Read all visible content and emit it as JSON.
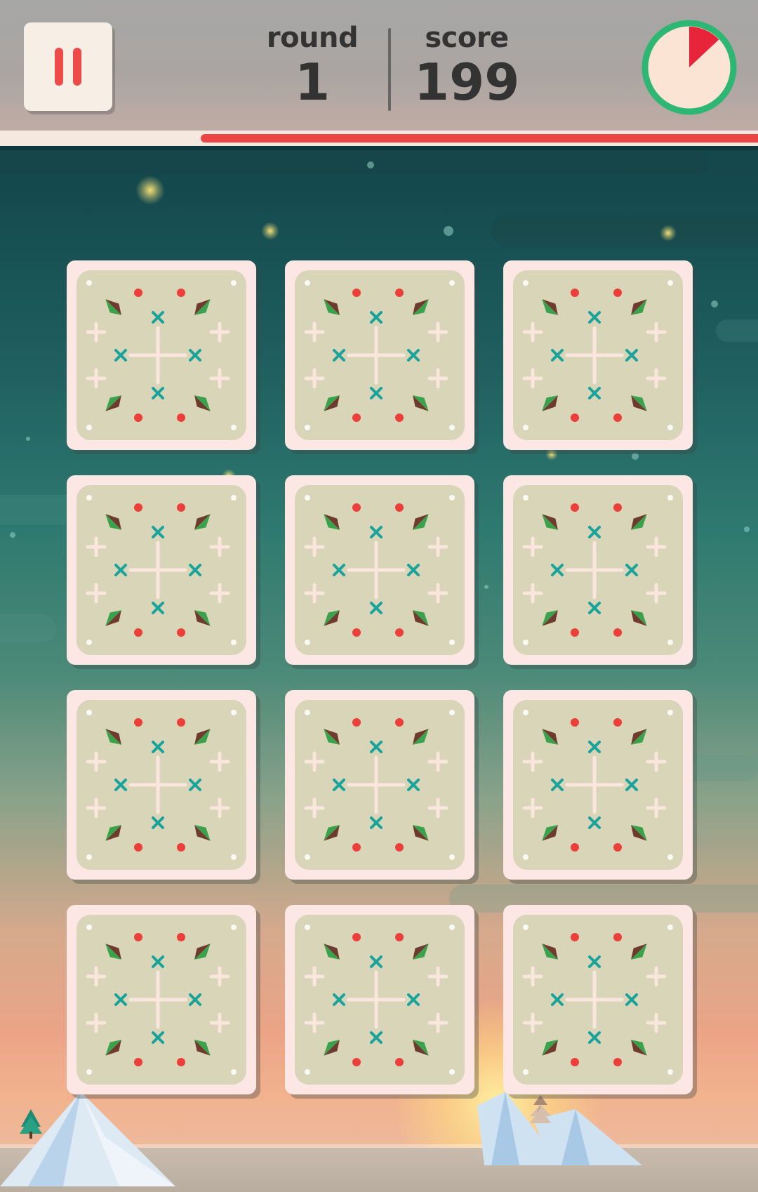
{
  "hud": {
    "pause_icon": "pause-icon",
    "round_label": "round",
    "round_value": "1",
    "score_label": "score",
    "score_value": "199",
    "timer_icon": "timer-pie-icon",
    "timer_remaining_fraction": 0.87,
    "time_bar_fraction": 0.735
  },
  "board": {
    "columns": 3,
    "rows": 4,
    "cards": [
      {
        "state": "face-down"
      },
      {
        "state": "face-down"
      },
      {
        "state": "face-down"
      },
      {
        "state": "face-down"
      },
      {
        "state": "face-down"
      },
      {
        "state": "face-down"
      },
      {
        "state": "face-down"
      },
      {
        "state": "face-down"
      },
      {
        "state": "face-down"
      },
      {
        "state": "face-down"
      },
      {
        "state": "face-down"
      },
      {
        "state": "face-down"
      }
    ],
    "card_back_icon": "card-back-pattern-icon"
  },
  "colors": {
    "accent_red": "#ec4545",
    "timer_green": "#2eb673",
    "card_face": "#fde7e4",
    "card_inner": "#d8d5b8",
    "pattern_teal": "#19a39a",
    "pattern_green": "#3aa24a",
    "pattern_brown": "#6e3b2e"
  }
}
